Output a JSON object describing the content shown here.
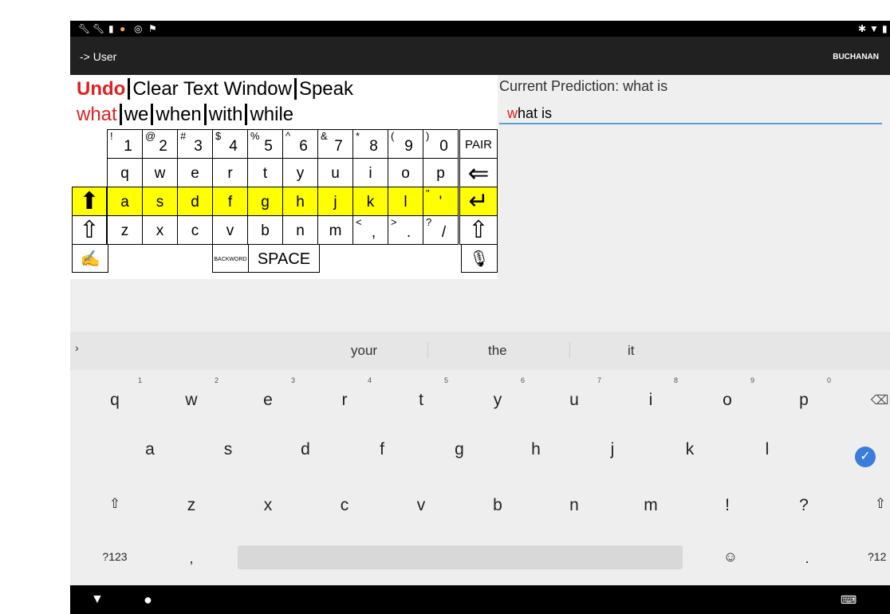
{
  "status_bar": {
    "left_icons": [
      "wrench-icon",
      "wrench-icon",
      "clipboard-icon",
      "sync-icon",
      "circle-icon",
      "flag-icon"
    ],
    "right_icons": [
      "bluetooth-icon",
      "wifi-icon",
      "battery-icon"
    ]
  },
  "title_bar": {
    "title": "-> User",
    "user": "BUCHANAN"
  },
  "toolbar_row": {
    "undo": "Undo",
    "clear": "Clear Text Window",
    "speak": "Speak"
  },
  "word_predictions": [
    "what",
    "we",
    "when",
    "with",
    "while"
  ],
  "current_prediction": {
    "label": "Current Prediction: what is",
    "value_highlight": "w",
    "value_rest": "hat is"
  },
  "aac_keys": {
    "numbers": [
      [
        "!",
        "1"
      ],
      [
        "@",
        "2"
      ],
      [
        "#",
        "3"
      ],
      [
        "$",
        "4"
      ],
      [
        "%",
        "5"
      ],
      [
        "^",
        "6"
      ],
      [
        "&",
        "7"
      ],
      [
        "*",
        "8"
      ],
      [
        "(",
        "9"
      ],
      [
        ")",
        "0"
      ]
    ],
    "pair": "PAIR",
    "row_q": [
      "q",
      "w",
      "e",
      "r",
      "t",
      "y",
      "u",
      "i",
      "o",
      "p"
    ],
    "row_a": [
      "a",
      "s",
      "d",
      "f",
      "g",
      "h",
      "j",
      "k",
      "l"
    ],
    "row_a_quote": [
      "\"",
      "'"
    ],
    "row_z": [
      "z",
      "x",
      "c",
      "v",
      "b",
      "n",
      "m"
    ],
    "row_z_punct": [
      [
        "<",
        ","
      ],
      [
        ">",
        "."
      ],
      [
        "?",
        "/"
      ]
    ],
    "backword": "BACKWORD",
    "space": "SPACE"
  },
  "keyboard": {
    "suggestions": [
      "your",
      "the",
      "it"
    ],
    "row1": [
      [
        "q",
        "1"
      ],
      [
        "w",
        "2"
      ],
      [
        "e",
        "3"
      ],
      [
        "r",
        "4"
      ],
      [
        "t",
        "5"
      ],
      [
        "y",
        "6"
      ],
      [
        "u",
        "7"
      ],
      [
        "i",
        "8"
      ],
      [
        "o",
        "9"
      ],
      [
        "p",
        "0"
      ]
    ],
    "row2": [
      "a",
      "s",
      "d",
      "f",
      "g",
      "h",
      "j",
      "k",
      "l"
    ],
    "row3": [
      "z",
      "x",
      "c",
      "v",
      "b",
      "n",
      "m",
      "!",
      "?"
    ],
    "row4": {
      "symbols": "?123",
      "comma": ",",
      "period": ".",
      "symbols_right": "?12"
    }
  },
  "colors": {
    "highlight_yellow": "#ffff00",
    "prediction_red": "#e02020",
    "accent_blue": "#3b7ddd"
  }
}
